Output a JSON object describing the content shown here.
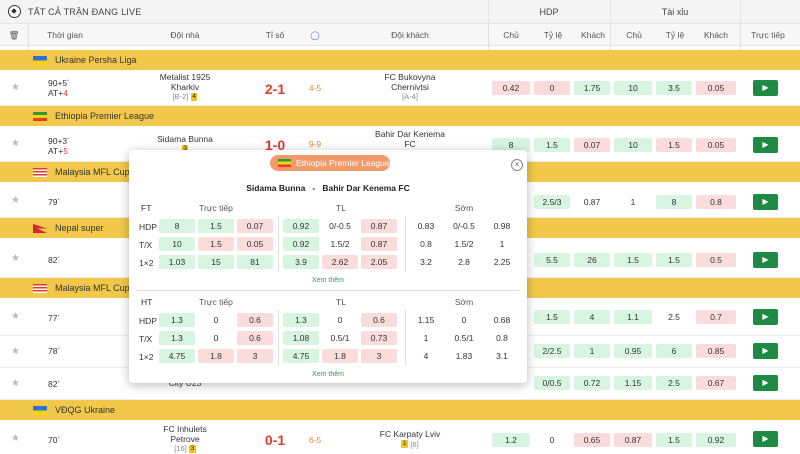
{
  "header": {
    "title": "TẤT CẢ TRẬN ĐANG LIVE",
    "hdp": "HDP",
    "taixiu": "Tài xỉu"
  },
  "columns": {
    "time": "Thời gian",
    "home": "Đội nhà",
    "score": "Tỉ số",
    "away": "Đội khách",
    "chu1": "Chủ",
    "tyle1": "Tỷ lệ",
    "khach1": "Khách",
    "chu2": "Chủ",
    "tyle2": "Tỷ lệ",
    "khach2": "Khách",
    "live": "Trực tiếp"
  },
  "leagues": [
    {
      "name": "Ukraine Persha Liga"
    },
    {
      "name": "Ethiopia Premier League"
    },
    {
      "name": "Malaysia MFL Cup"
    },
    {
      "name": "Nepal super"
    },
    {
      "name": "Malaysia MFL Cup"
    },
    {
      "name": "VĐQG Ukraine"
    }
  ],
  "matches": [
    {
      "time": "90+5´",
      "at": "AT+",
      "at_n": "4",
      "home": "Metalist 1925",
      "home2": "Kharkiv",
      "home_rank": "[B-2]",
      "home_card": "4",
      "score": "2-1",
      "ht": "4-5",
      "away": "FC Bukovyna",
      "away2": "Chernivtsi",
      "away_rank": "[A-4]",
      "o": [
        "0.42",
        "0",
        "1.75",
        "10",
        "3.5",
        "0.05"
      ]
    },
    {
      "time": "90+3´",
      "at": "AT+",
      "at_n": "5",
      "home": "Sidama Bunna",
      "home_card": "3",
      "score": "1-0",
      "ht": "9-9",
      "away": "Bahir Dar Kenema",
      "away2": "FC",
      "o": [
        "8",
        "1.5",
        "0.07",
        "10",
        "1.5",
        "0.05"
      ]
    },
    {
      "time": "79´",
      "o": [
        "2.5/3",
        "0.87",
        "1",
        "8",
        "0.8"
      ]
    },
    {
      "time": "82´",
      "o": [
        "5.5",
        "26",
        "1.5",
        "1.5",
        "0.5"
      ]
    },
    {
      "time": "77´",
      "o": [
        "1.5",
        "4",
        "1.1",
        "2.5",
        "0.7"
      ]
    },
    {
      "time": "78´",
      "o": [
        "2/2.5",
        "1",
        "0.95",
        "6",
        "0.85"
      ]
    },
    {
      "time": "82´",
      "home_frag": "City U23",
      "o": [
        "0/0.5",
        "0.72",
        "1.15",
        "2.5",
        "0.67"
      ]
    },
    {
      "time": "70´",
      "home": "FC Inhulets",
      "home2": "Petrove",
      "home_rank": "[16]",
      "home_card": "3",
      "score": "0-1",
      "ht": "6-5",
      "away": "FC Karpaty Lviv",
      "away_rank": "[6]",
      "away_card": "1",
      "o": [
        "1.2",
        "0",
        "0.65",
        "0.87",
        "1.5",
        "0.92"
      ]
    }
  ],
  "popup": {
    "league": "Ethiopia Premier League",
    "home": "Sidama Bunna",
    "sep": "-",
    "away": "Bahir Dar Kenema FC",
    "ft": {
      "label": "FT",
      "h_live": "Trực tiếp",
      "h_tl": "TL",
      "h_som": "Sớm",
      "rows": [
        {
          "label": "HDP",
          "live": [
            "8",
            "1.5",
            "0.07"
          ],
          "tl": [
            "0.92",
            "0/-0.5",
            "0.87"
          ],
          "som": [
            "0.83",
            "0/-0.5",
            "0.98"
          ]
        },
        {
          "label": "T/X",
          "live": [
            "10",
            "1.5",
            "0.05"
          ],
          "tl": [
            "0.92",
            "1.5/2",
            "0.87"
          ],
          "som": [
            "0.8",
            "1.5/2",
            "1"
          ]
        },
        {
          "label": "1×2",
          "live": [
            "1.03",
            "15",
            "81"
          ],
          "tl": [
            "3.9",
            "2.62",
            "2.05"
          ],
          "som": [
            "3.2",
            "2.8",
            "2.25"
          ]
        }
      ],
      "more": "Xem thêm"
    },
    "ht": {
      "label": "HT",
      "h_live": "Trực tiếp",
      "h_tl": "TL",
      "h_som": "Sớm",
      "rows": [
        {
          "label": "HDP",
          "live": [
            "1.3",
            "0",
            "0.6"
          ],
          "tl": [
            "1.3",
            "0",
            "0.6"
          ],
          "som": [
            "1.15",
            "0",
            "0.68"
          ]
        },
        {
          "label": "T/X",
          "live": [
            "1.3",
            "0",
            "0.6"
          ],
          "tl": [
            "1.08",
            "0.5/1",
            "0.73"
          ],
          "som": [
            "1",
            "0.5/1",
            "0.8"
          ]
        },
        {
          "label": "1×2",
          "live": [
            "4.75",
            "1.8",
            "3"
          ],
          "tl": [
            "4.75",
            "1.8",
            "3"
          ],
          "som": [
            "4",
            "1.83",
            "3.1"
          ]
        }
      ],
      "more": "Xem thêm"
    }
  },
  "icons": {
    "live": "▶"
  },
  "colors": {
    "league_bar": "#f2c84b",
    "score": "#e23b2e",
    "live_btn": "#1e8a44",
    "odds_green": "#d7f5e1",
    "odds_pink": "#fbdcdc",
    "popup_tab": "#f29a6a"
  }
}
